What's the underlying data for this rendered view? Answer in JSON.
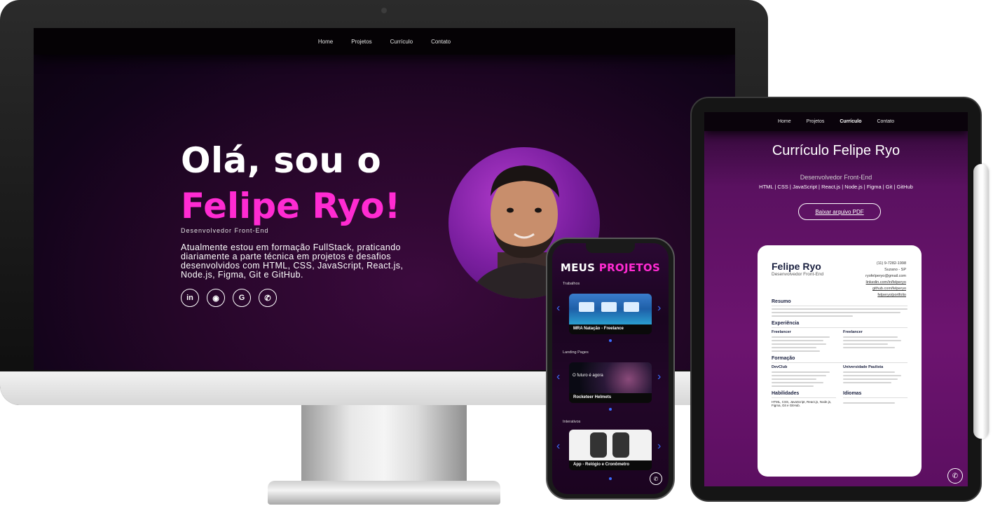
{
  "desktop": {
    "nav": [
      "Home",
      "Projetos",
      "Currículo",
      "Contato"
    ],
    "hero": {
      "greeting": "Olá, sou o",
      "name": "Felipe Ryo!",
      "role": "Desenvolvedor Front-End",
      "description": "Atualmente estou em formação FullStack, praticando diariamente a parte técnica em projetos e desafios desenvolvidos com HTML, CSS, JavaScript, React.js, Node.js, Figma, Git e GitHub."
    },
    "socials": [
      {
        "icon": "linkedin-icon",
        "glyph": "in"
      },
      {
        "icon": "github-icon",
        "glyph": "◉"
      },
      {
        "icon": "google-icon",
        "glyph": "G"
      },
      {
        "icon": "whatsapp-icon",
        "glyph": "✆"
      }
    ]
  },
  "tablet": {
    "nav": [
      "Home",
      "Projetos",
      "Currículo",
      "Contato"
    ],
    "active_nav": "Currículo",
    "title": "Currículo Felipe Ryo",
    "role": "Desenvolvedor Front-End",
    "stack": "HTML | CSS | JavaScript | React.js | Node.js | Figma | Git | GitHub",
    "download_button": "Baixar arquivo PDF",
    "resume": {
      "name": "Felipe Ryo",
      "subtitle": "Desenvolvedor Front-End",
      "contacts": [
        "(11) 9-7282-1998",
        "Suzano - SP",
        "ryofelperyo@gmail.com",
        "linkedin.com/in/felperyo",
        "github.com/felperyo",
        "felperyo/portfolio"
      ],
      "sections": {
        "summary": "Resumo",
        "experience": "Experiência",
        "education": "Formação",
        "skills": "Habilidades",
        "languages": "Idiomas"
      },
      "experience_entries": [
        "Freelancer",
        "Freelancer"
      ],
      "education_entries": [
        "DevClub",
        "Universidade Paulista"
      ],
      "skills_text": "HTML, CSS, JavaScript, React.js, Node.js, Figma, Git e GitHub."
    }
  },
  "phone": {
    "title_white": "MEUS",
    "title_pink": "PROJETOS",
    "sections": [
      {
        "label": "Trabalhos",
        "card": "MRA Natação - Freelance"
      },
      {
        "label": "Landing Pages",
        "card": "Rocketeer Helmets",
        "card_overlay": "O futuro é agora"
      },
      {
        "label": "Interativos",
        "card": "App - Relógio e Cronômetro"
      }
    ]
  },
  "colors": {
    "accent_pink": "#ff2bd2",
    "background_purple": "#6d1470",
    "carousel_blue": "#3b6cff"
  }
}
